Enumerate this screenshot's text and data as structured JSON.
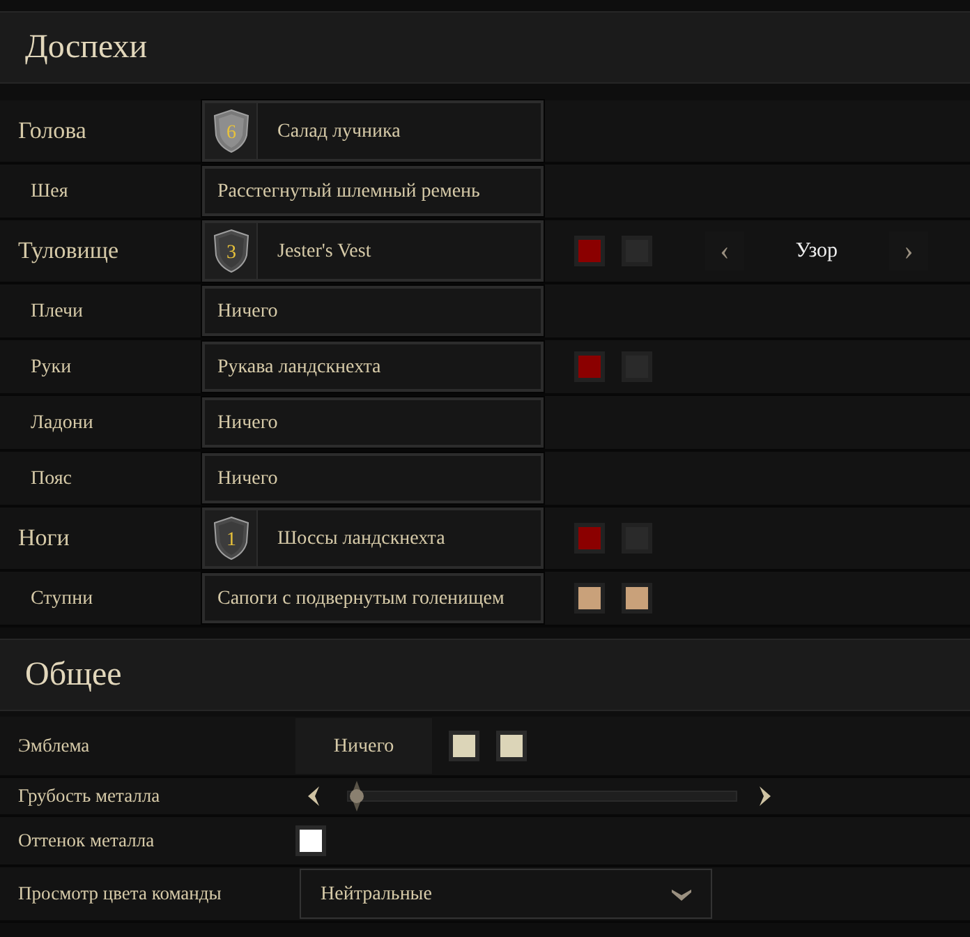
{
  "armor": {
    "title": "Доспехи",
    "slots": [
      {
        "label": "Голова",
        "major": true,
        "item": "Салад лучника",
        "tier": "6"
      },
      {
        "label": "Шея",
        "major": false,
        "item": "Расстегнутый шлемный ремень"
      },
      {
        "label": "Туловище",
        "major": true,
        "item": "Jester's Vest",
        "tier": "3",
        "swatches": [
          {
            "color": "#8b0000"
          },
          {
            "color": "#2a2a2a"
          }
        ],
        "pattern": {
          "prev": "‹",
          "label": "Узор",
          "next": "›"
        }
      },
      {
        "label": "Плечи",
        "major": false,
        "item": "Ничего"
      },
      {
        "label": "Руки",
        "major": false,
        "item": "Рукава ландскнехта",
        "swatches": [
          {
            "color": "#8b0000"
          },
          {
            "color": "#2a2a2a"
          }
        ]
      },
      {
        "label": "Ладони",
        "major": false,
        "item": "Ничего"
      },
      {
        "label": "Пояс",
        "major": false,
        "item": "Ничего"
      },
      {
        "label": "Ноги",
        "major": true,
        "item": "Шоссы ландскнехта",
        "tier": "1",
        "swatches": [
          {
            "color": "#8b0000"
          },
          {
            "color": "#2a2a2a"
          }
        ]
      },
      {
        "label": "Ступни",
        "major": false,
        "item": "Сапоги с подвернутым голенищем",
        "swatches": [
          {
            "color": "#c9a17a"
          },
          {
            "color": "#c9a17a"
          }
        ]
      }
    ]
  },
  "general": {
    "title": "Общее",
    "rows": [
      {
        "kind": "button",
        "label": "Эмблема",
        "value": "Ничего",
        "swatches": [
          {
            "color": "#dcd5b8"
          },
          {
            "color": "#dcd5b8"
          }
        ]
      },
      {
        "kind": "slider",
        "label": "Грубость металла",
        "level": 0.0
      },
      {
        "kind": "swatch",
        "label": "Оттенок металла",
        "color": "#ffffff"
      },
      {
        "kind": "dropdown",
        "label": "Просмотр цвета команды",
        "value": "Нейтральные"
      }
    ]
  }
}
